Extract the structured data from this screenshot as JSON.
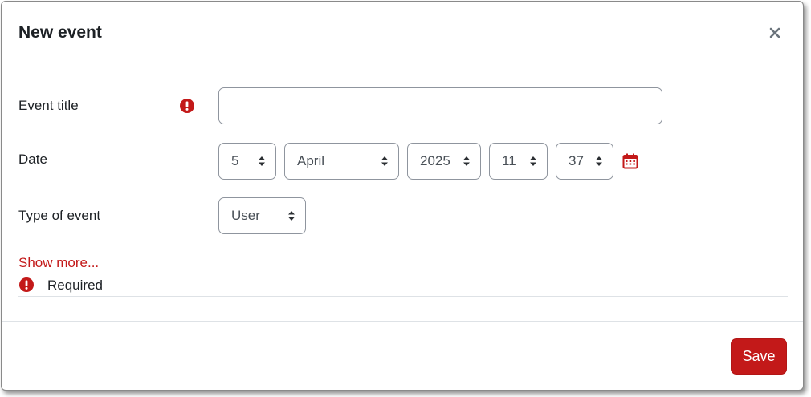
{
  "modal": {
    "title": "New event"
  },
  "form": {
    "event_title": {
      "label": "Event title",
      "value": "",
      "required": true
    },
    "date": {
      "label": "Date",
      "day": "5",
      "month": "April",
      "year": "2025",
      "hour": "11",
      "minute": "37"
    },
    "type_of_event": {
      "label": "Type of event",
      "value": "User"
    },
    "show_more_label": "Show more...",
    "required_note": "Required"
  },
  "footer": {
    "save_label": "Save"
  },
  "colors": {
    "accent": "#c31919",
    "border": "#8f959e",
    "text": "#1d2125"
  },
  "icons": {
    "required": "exclamation-circle-icon",
    "calendar": "calendar-icon",
    "close": "close-icon",
    "select_arrows": "sort-arrows-icon"
  }
}
